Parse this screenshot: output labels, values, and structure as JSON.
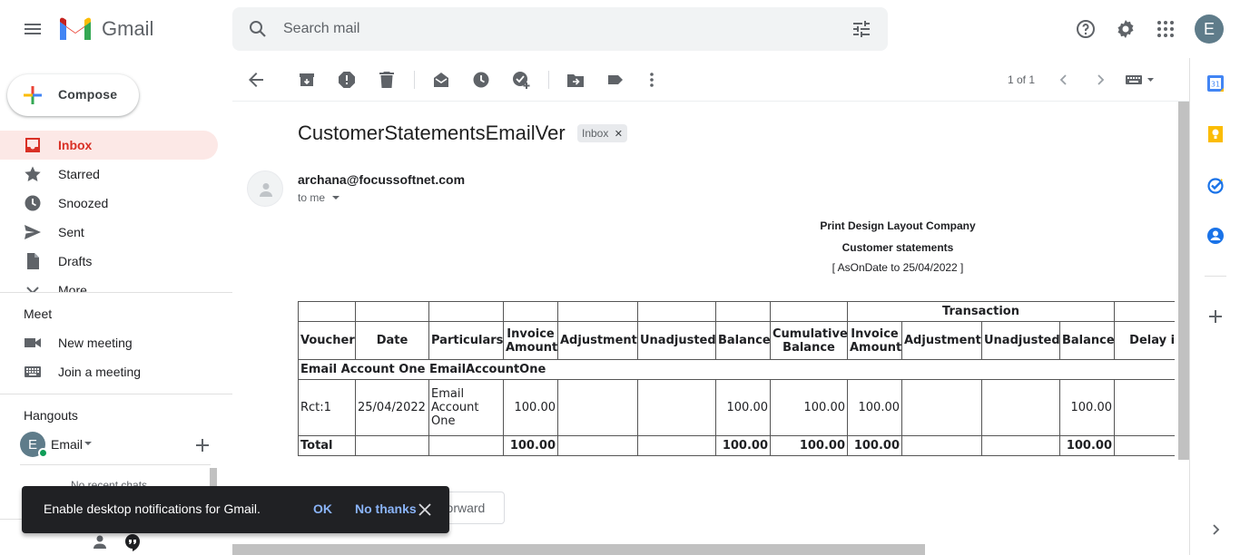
{
  "app": {
    "name": "Gmail"
  },
  "search": {
    "placeholder": "Search mail"
  },
  "account": {
    "initial": "E"
  },
  "compose": {
    "label": "Compose"
  },
  "nav": [
    {
      "label": "Inbox",
      "icon": "inbox-icon",
      "active": true
    },
    {
      "label": "Starred",
      "icon": "star-icon"
    },
    {
      "label": "Snoozed",
      "icon": "clock-icon"
    },
    {
      "label": "Sent",
      "icon": "send-icon"
    },
    {
      "label": "Drafts",
      "icon": "draft-icon"
    },
    {
      "label": "More",
      "icon": "chevron-down-icon"
    }
  ],
  "meet": {
    "title": "Meet",
    "new_meeting": "New meeting",
    "join_meeting": "Join a meeting"
  },
  "hangouts": {
    "title": "Hangouts",
    "user_initial": "E",
    "user_name": "Email",
    "no_chats": "No recent chats"
  },
  "toast": {
    "text": "Enable desktop notifications for Gmail.",
    "ok": "OK",
    "no_thanks": "No thanks"
  },
  "toolbar": {
    "pager": "1 of 1"
  },
  "email": {
    "subject": "CustomerStatementsEmailVer",
    "label": "Inbox",
    "sender": "archana@focussoftnet.com",
    "recipient": "to me",
    "company": "Print Design Layout Company",
    "report": "Customer statements",
    "as_on_date": "[ AsOnDate to 25/04/2022 ]",
    "table": {
      "group_header": "Transaction",
      "columns": [
        "Voucher",
        "Date",
        "Particulars",
        "Invoice Amount",
        "Adjustment",
        "Unadjusted",
        "Balance",
        "Cumulative Balance",
        "Invoice Amount",
        "Adjustment",
        "Unadjusted",
        "Balance",
        "Delay in payment"
      ],
      "section": "Email Account One EmailAccountOne",
      "rows": [
        [
          "Rct:1",
          "25/04/2022",
          "Email Account One",
          "100.00",
          "",
          "",
          "100.00",
          "100.00",
          "100.00",
          "",
          "",
          "100.00",
          ""
        ]
      ],
      "total": [
        "Total",
        "",
        "",
        "100.00",
        "",
        "",
        "100.00",
        "100.00",
        "100.00",
        "",
        "",
        "100.00",
        ""
      ]
    },
    "forward_label": "Forward"
  },
  "colors": {
    "accent_red": "#d93025",
    "inbox_bg": "#fce8e6",
    "toast_bg": "#202124",
    "toast_link": "#8ab4f8"
  }
}
